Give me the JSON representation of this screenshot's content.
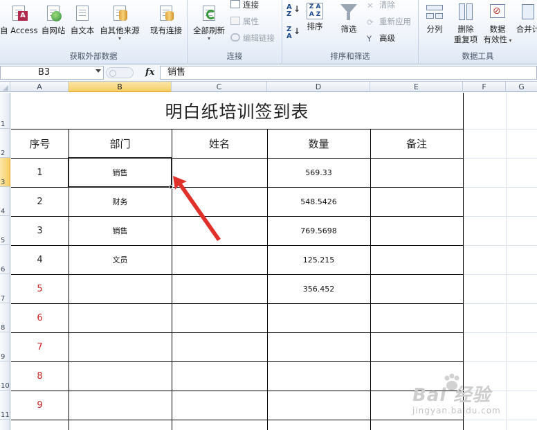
{
  "ribbon": {
    "groups": [
      {
        "label": "获取外部数据"
      },
      {
        "label": "连接"
      },
      {
        "label": "排序和筛选"
      },
      {
        "label": "数据工具"
      }
    ],
    "buttons": {
      "access": "自 Access",
      "web": "自网站",
      "text": "自文本",
      "other_sources": "自其他来源",
      "existing_connections": "现有连接",
      "refresh_all": "全部刷新",
      "connections": "连接",
      "properties": "属性",
      "edit_links": "编辑链接",
      "sort": "排序",
      "filter": "筛选",
      "clear": "清除",
      "reapply": "重新应用",
      "advanced": "高级",
      "text_to_columns": "分列",
      "remove_duplicates_1": "删除",
      "remove_duplicates_2": "重复项",
      "data_validation_1": "数据",
      "data_validation_2": "有效性",
      "consolidate": "合并计"
    }
  },
  "formula_bar": {
    "name_box": "B3",
    "fx": "fx",
    "content": "销售"
  },
  "columns": [
    "A",
    "B",
    "C",
    "D",
    "E",
    "F",
    "G"
  ],
  "rows": [
    "1",
    "2",
    "3",
    "4",
    "5",
    "6",
    "7",
    "8",
    "9",
    "10",
    "11"
  ],
  "sheet": {
    "title": "明白纸培训签到表",
    "headers": [
      "序号",
      "部门",
      "姓名",
      "数量",
      "备注"
    ],
    "data": [
      {
        "no": "1",
        "dept": "销售",
        "name": "",
        "qty": "569.33",
        "note": ""
      },
      {
        "no": "2",
        "dept": "财务",
        "name": "",
        "qty": "548.5426",
        "note": ""
      },
      {
        "no": "3",
        "dept": "销售",
        "name": "",
        "qty": "769.5698",
        "note": ""
      },
      {
        "no": "4",
        "dept": "文员",
        "name": "",
        "qty": "125.215",
        "note": ""
      },
      {
        "no": "5",
        "dept": "",
        "name": "",
        "qty": "356.452",
        "note": ""
      },
      {
        "no": "6",
        "dept": "",
        "name": "",
        "qty": "",
        "note": ""
      },
      {
        "no": "7",
        "dept": "",
        "name": "",
        "qty": "",
        "note": ""
      },
      {
        "no": "8",
        "dept": "",
        "name": "",
        "qty": "",
        "note": ""
      },
      {
        "no": "9",
        "dept": "",
        "name": "",
        "qty": "",
        "note": ""
      }
    ]
  },
  "selected_cell": "B3",
  "watermark": {
    "main": "Bai 经验",
    "sub": "jingyan.baidu.com"
  },
  "colors": {
    "red_number": "#c82323",
    "selection": "#1f1f1f",
    "arrow": "#e0302a",
    "header_selected": "#f6cd64"
  }
}
